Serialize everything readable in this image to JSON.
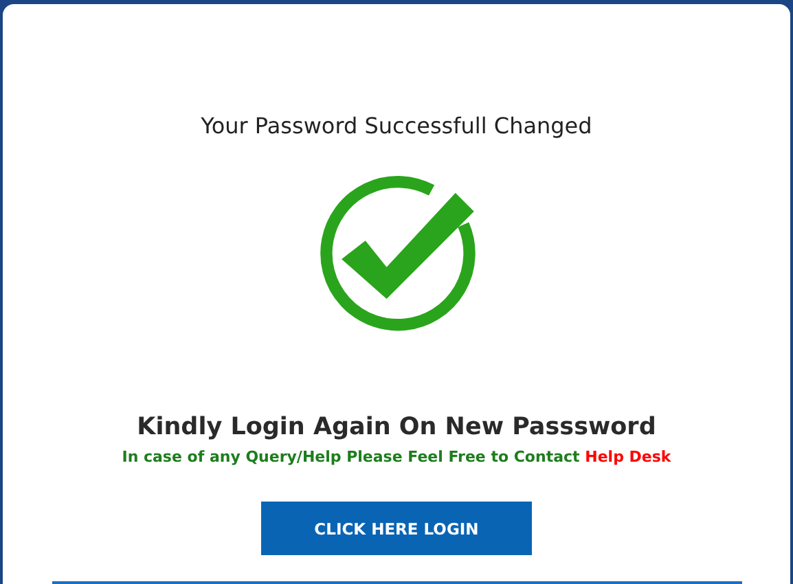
{
  "message": "Your Password Successfull Changed",
  "heading": "Kindly Login Again On New Passsword",
  "help": {
    "text": "In case of any Query/Help Please Feel Free to Contact",
    "link": "Help Desk"
  },
  "button": "CLICK HERE LOGIN"
}
